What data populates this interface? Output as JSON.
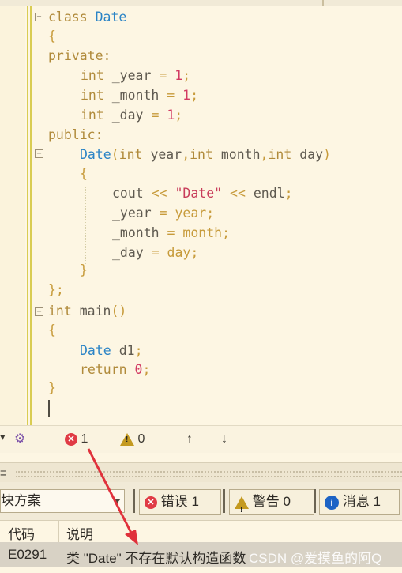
{
  "editor": {
    "lines": [
      "class Date",
      "{",
      "private:",
      "int _year = 1;",
      "int _month = 1;",
      "int _day = 1;",
      "public:",
      "Date(int year,int month,int day)",
      "{",
      "cout << \"Date\" << endl;",
      "_year = year;",
      "_month = month;",
      "_day = day;",
      "}",
      "};",
      "int main()",
      "{",
      "Date d1;",
      "return 0;",
      "}"
    ]
  },
  "status_bar": {
    "error_count": "1",
    "warning_count": "0",
    "up_arrow": "↑",
    "down_arrow": "↓"
  },
  "error_list": {
    "scope_selector": "块方案",
    "errors_button": "错误 1",
    "warnings_button": "警告 0",
    "messages_button": "消息 1",
    "columns": [
      "代码",
      "说明"
    ],
    "rows": [
      {
        "code": "E0291",
        "description": "类 \"Date\" 不存在默认构造函数"
      }
    ]
  },
  "watermark": "CSDN @爱摸鱼的阿Q",
  "colors": {
    "editor_bg": "#fdf6e3",
    "keyword": "#b08a3a",
    "type": "#2b84c6",
    "number": "#d23a63",
    "error": "#e03b45",
    "warning": "#c49a20",
    "info": "#1d63c5",
    "annotation_arrow": "#e0313b"
  }
}
